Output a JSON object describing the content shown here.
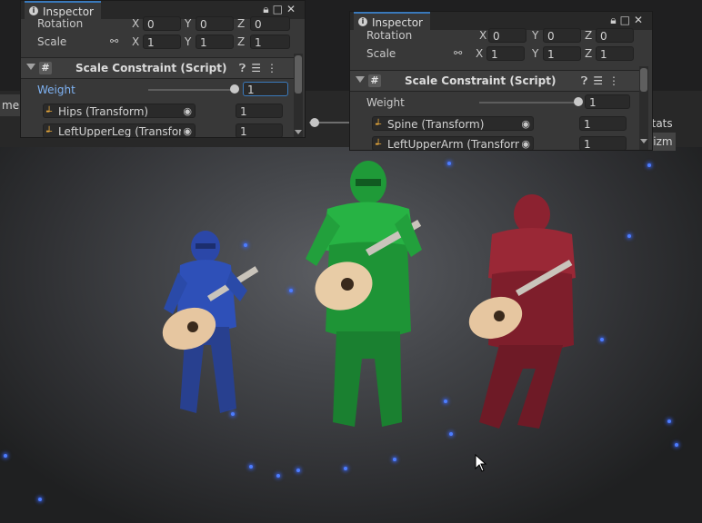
{
  "scene_view": {
    "tab_partial": "me",
    "stats_label": "Stats",
    "gizmos_partial": "Gizm"
  },
  "inspector_left": {
    "tab_title": "Inspector",
    "rotation": {
      "label": "Rotation",
      "x": "0",
      "y": "0",
      "z": "0"
    },
    "scale": {
      "label": "Scale",
      "x": "1",
      "y": "1",
      "z": "1"
    },
    "component_title": "Scale Constraint (Script)",
    "weight": {
      "label": "Weight",
      "value": "1",
      "level": 1.0
    },
    "sources": [
      {
        "name": "Hips (Transform)",
        "weight": "1"
      },
      {
        "name": "LeftUpperLeg (Transfor",
        "weight": "1"
      }
    ]
  },
  "inspector_right": {
    "tab_title": "Inspector",
    "rotation": {
      "label": "Rotation",
      "x": "0",
      "y": "0",
      "z": "0"
    },
    "scale": {
      "label": "Scale",
      "x": "1",
      "y": "1",
      "z": "1"
    },
    "component_title": "Scale Constraint (Script)",
    "weight": {
      "label": "Weight",
      "value": "1",
      "level": 1.0
    },
    "sources": [
      {
        "name": "Spine (Transform)",
        "weight": "1"
      },
      {
        "name": "LeftUpperArm (Transform",
        "weight": "1"
      }
    ]
  },
  "axis_labels": {
    "x": "X",
    "y": "Y",
    "z": "Z"
  },
  "icons": {
    "info": "info-icon",
    "lock": "lock-icon",
    "maximize": "maximize-icon",
    "close": "close-icon",
    "help": "help-icon",
    "settings": "preset-icon",
    "menu": "kebab-menu-icon",
    "link": "constrain-proportions-icon",
    "target": "object-picker-icon",
    "transform": "transform-icon"
  },
  "colors": {
    "accent": "#3a79bb",
    "weight_label": "#7fb3f4",
    "character_blue": "#2d4fb8",
    "character_green": "#1f9a38",
    "character_red": "#8e2230"
  }
}
